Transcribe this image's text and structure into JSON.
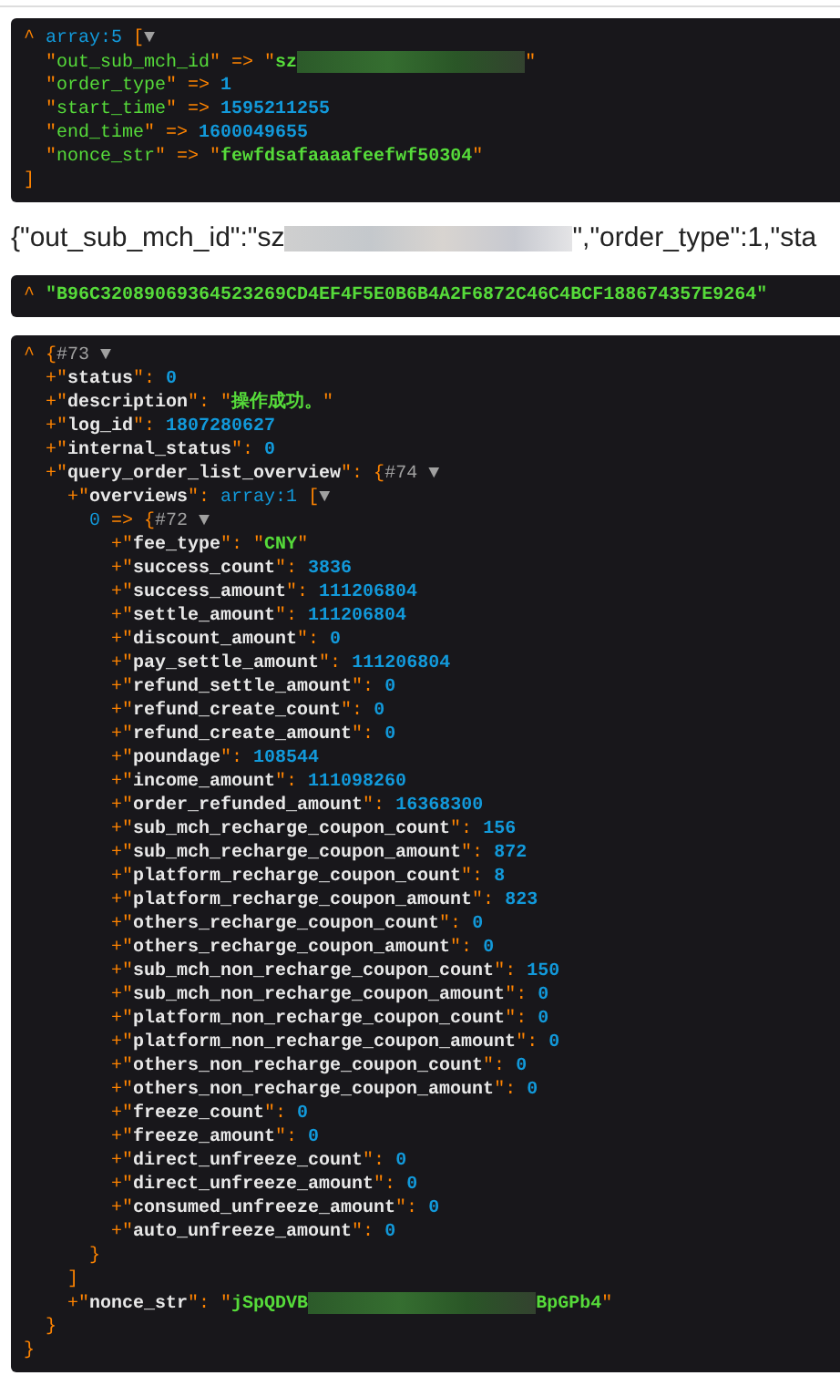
{
  "dumps": [
    {
      "kind": "dark",
      "root": {
        "tokens": [
          {
            "kind": "punct",
            "text": "^ "
          },
          {
            "kind": "type",
            "text": "array:5"
          },
          {
            "kind": "punct",
            "text": " ["
          },
          {
            "kind": "toggle",
            "text": "▼"
          }
        ],
        "children": [
          {
            "tokens": [
              {
                "kind": "punct",
                "text": "\""
              },
              {
                "kind": "str",
                "text": "out_sub_mch_id"
              },
              {
                "kind": "punct",
                "text": "\" => \""
              },
              {
                "kind": "strb",
                "text": "sz"
              },
              {
                "kind": "redacted"
              },
              {
                "kind": "punct",
                "text": "\""
              }
            ]
          },
          {
            "tokens": [
              {
                "kind": "punct",
                "text": "\""
              },
              {
                "kind": "str",
                "text": "order_type"
              },
              {
                "kind": "punct",
                "text": "\" => "
              },
              {
                "kind": "num",
                "text": "1"
              }
            ]
          },
          {
            "tokens": [
              {
                "kind": "punct",
                "text": "\""
              },
              {
                "kind": "str",
                "text": "start_time"
              },
              {
                "kind": "punct",
                "text": "\" => "
              },
              {
                "kind": "num",
                "text": "1595211255"
              }
            ]
          },
          {
            "tokens": [
              {
                "kind": "punct",
                "text": "\""
              },
              {
                "kind": "str",
                "text": "end_time"
              },
              {
                "kind": "punct",
                "text": "\" => "
              },
              {
                "kind": "num",
                "text": "1600049655"
              }
            ]
          },
          {
            "tokens": [
              {
                "kind": "punct",
                "text": "\""
              },
              {
                "kind": "str",
                "text": "nonce_str"
              },
              {
                "kind": "punct",
                "text": "\" => \""
              },
              {
                "kind": "strb",
                "text": "fewfdsafaaaafeefwf50304"
              },
              {
                "kind": "punct",
                "text": "\""
              }
            ]
          }
        ],
        "closing": [
          {
            "kind": "punct",
            "text": "]"
          }
        ]
      }
    },
    {
      "kind": "plain",
      "tokens": [
        {
          "kind": "plain",
          "text": "{\"out_sub_mch_id\":\"sz"
        },
        {
          "kind": "redacted"
        },
        {
          "kind": "plain",
          "text": "\",\"order_type\":1,\"sta"
        }
      ]
    },
    {
      "kind": "dark",
      "root": {
        "tokens": [
          {
            "kind": "punct",
            "text": "^ "
          },
          {
            "kind": "strb",
            "text": "\"B96C32089069364523269CD4EF4F5E0B6B4A2F6872C46C4BCF188674357E9264\""
          }
        ]
      }
    },
    {
      "kind": "dark",
      "root": {
        "tokens": [
          {
            "kind": "punct",
            "text": "^ {"
          },
          {
            "kind": "meta",
            "text": "#73"
          },
          {
            "kind": "toggle",
            "text": " ▼"
          }
        ],
        "children": [
          {
            "tokens": [
              {
                "kind": "punct",
                "text": "+\""
              },
              {
                "kind": "key",
                "text": "status"
              },
              {
                "kind": "punct",
                "text": "\": "
              },
              {
                "kind": "num",
                "text": "0"
              }
            ]
          },
          {
            "tokens": [
              {
                "kind": "punct",
                "text": "+\""
              },
              {
                "kind": "key",
                "text": "description"
              },
              {
                "kind": "punct",
                "text": "\": \""
              },
              {
                "kind": "strb",
                "text": "操作成功。"
              },
              {
                "kind": "punct",
                "text": "\""
              }
            ]
          },
          {
            "tokens": [
              {
                "kind": "punct",
                "text": "+\""
              },
              {
                "kind": "key",
                "text": "log_id"
              },
              {
                "kind": "punct",
                "text": "\": "
              },
              {
                "kind": "num",
                "text": "1807280627"
              }
            ]
          },
          {
            "tokens": [
              {
                "kind": "punct",
                "text": "+\""
              },
              {
                "kind": "key",
                "text": "internal_status"
              },
              {
                "kind": "punct",
                "text": "\": "
              },
              {
                "kind": "num",
                "text": "0"
              }
            ]
          },
          {
            "tokens": [
              {
                "kind": "punct",
                "text": "+\""
              },
              {
                "kind": "key",
                "text": "query_order_list_overview"
              },
              {
                "kind": "punct",
                "text": "\": {"
              },
              {
                "kind": "meta",
                "text": "#74"
              },
              {
                "kind": "toggle",
                "text": " ▼"
              }
            ],
            "children": [
              {
                "tokens": [
                  {
                    "kind": "punct",
                    "text": "+\""
                  },
                  {
                    "kind": "key",
                    "text": "overviews"
                  },
                  {
                    "kind": "punct",
                    "text": "\": "
                  },
                  {
                    "kind": "type",
                    "text": "array:1"
                  },
                  {
                    "kind": "punct",
                    "text": " ["
                  },
                  {
                    "kind": "toggle",
                    "text": "▼"
                  }
                ],
                "children": [
                  {
                    "tokens": [
                      {
                        "kind": "type",
                        "text": "0"
                      },
                      {
                        "kind": "punct",
                        "text": " => {"
                      },
                      {
                        "kind": "meta",
                        "text": "#72"
                      },
                      {
                        "kind": "toggle",
                        "text": " ▼"
                      }
                    ],
                    "children": [
                      {
                        "tokens": [
                          {
                            "kind": "punct",
                            "text": "+\""
                          },
                          {
                            "kind": "key",
                            "text": "fee_type"
                          },
                          {
                            "kind": "punct",
                            "text": "\": \""
                          },
                          {
                            "kind": "strb",
                            "text": "CNY"
                          },
                          {
                            "kind": "punct",
                            "text": "\""
                          }
                        ]
                      },
                      {
                        "tokens": [
                          {
                            "kind": "punct",
                            "text": "+\""
                          },
                          {
                            "kind": "key",
                            "text": "success_count"
                          },
                          {
                            "kind": "punct",
                            "text": "\": "
                          },
                          {
                            "kind": "num",
                            "text": "3836"
                          }
                        ]
                      },
                      {
                        "tokens": [
                          {
                            "kind": "punct",
                            "text": "+\""
                          },
                          {
                            "kind": "key",
                            "text": "success_amount"
                          },
                          {
                            "kind": "punct",
                            "text": "\": "
                          },
                          {
                            "kind": "num",
                            "text": "111206804"
                          }
                        ]
                      },
                      {
                        "tokens": [
                          {
                            "kind": "punct",
                            "text": "+\""
                          },
                          {
                            "kind": "key",
                            "text": "settle_amount"
                          },
                          {
                            "kind": "punct",
                            "text": "\": "
                          },
                          {
                            "kind": "num",
                            "text": "111206804"
                          }
                        ]
                      },
                      {
                        "tokens": [
                          {
                            "kind": "punct",
                            "text": "+\""
                          },
                          {
                            "kind": "key",
                            "text": "discount_amount"
                          },
                          {
                            "kind": "punct",
                            "text": "\": "
                          },
                          {
                            "kind": "num",
                            "text": "0"
                          }
                        ]
                      },
                      {
                        "tokens": [
                          {
                            "kind": "punct",
                            "text": "+\""
                          },
                          {
                            "kind": "key",
                            "text": "pay_settle_amount"
                          },
                          {
                            "kind": "punct",
                            "text": "\": "
                          },
                          {
                            "kind": "num",
                            "text": "111206804"
                          }
                        ]
                      },
                      {
                        "tokens": [
                          {
                            "kind": "punct",
                            "text": "+\""
                          },
                          {
                            "kind": "key",
                            "text": "refund_settle_amount"
                          },
                          {
                            "kind": "punct",
                            "text": "\": "
                          },
                          {
                            "kind": "num",
                            "text": "0"
                          }
                        ]
                      },
                      {
                        "tokens": [
                          {
                            "kind": "punct",
                            "text": "+\""
                          },
                          {
                            "kind": "key",
                            "text": "refund_create_count"
                          },
                          {
                            "kind": "punct",
                            "text": "\": "
                          },
                          {
                            "kind": "num",
                            "text": "0"
                          }
                        ]
                      },
                      {
                        "tokens": [
                          {
                            "kind": "punct",
                            "text": "+\""
                          },
                          {
                            "kind": "key",
                            "text": "refund_create_amount"
                          },
                          {
                            "kind": "punct",
                            "text": "\": "
                          },
                          {
                            "kind": "num",
                            "text": "0"
                          }
                        ]
                      },
                      {
                        "tokens": [
                          {
                            "kind": "punct",
                            "text": "+\""
                          },
                          {
                            "kind": "key",
                            "text": "poundage"
                          },
                          {
                            "kind": "punct",
                            "text": "\": "
                          },
                          {
                            "kind": "num",
                            "text": "108544"
                          }
                        ]
                      },
                      {
                        "tokens": [
                          {
                            "kind": "punct",
                            "text": "+\""
                          },
                          {
                            "kind": "key",
                            "text": "income_amount"
                          },
                          {
                            "kind": "punct",
                            "text": "\": "
                          },
                          {
                            "kind": "num",
                            "text": "111098260"
                          }
                        ]
                      },
                      {
                        "tokens": [
                          {
                            "kind": "punct",
                            "text": "+\""
                          },
                          {
                            "kind": "key",
                            "text": "order_refunded_amount"
                          },
                          {
                            "kind": "punct",
                            "text": "\": "
                          },
                          {
                            "kind": "num",
                            "text": "16368300"
                          }
                        ]
                      },
                      {
                        "tokens": [
                          {
                            "kind": "punct",
                            "text": "+\""
                          },
                          {
                            "kind": "key",
                            "text": "sub_mch_recharge_coupon_count"
                          },
                          {
                            "kind": "punct",
                            "text": "\": "
                          },
                          {
                            "kind": "num",
                            "text": "156"
                          }
                        ]
                      },
                      {
                        "tokens": [
                          {
                            "kind": "punct",
                            "text": "+\""
                          },
                          {
                            "kind": "key",
                            "text": "sub_mch_recharge_coupon_amount"
                          },
                          {
                            "kind": "punct",
                            "text": "\": "
                          },
                          {
                            "kind": "num",
                            "text": "872"
                          }
                        ]
                      },
                      {
                        "tokens": [
                          {
                            "kind": "punct",
                            "text": "+\""
                          },
                          {
                            "kind": "key",
                            "text": "platform_recharge_coupon_count"
                          },
                          {
                            "kind": "punct",
                            "text": "\": "
                          },
                          {
                            "kind": "num",
                            "text": "8"
                          }
                        ]
                      },
                      {
                        "tokens": [
                          {
                            "kind": "punct",
                            "text": "+\""
                          },
                          {
                            "kind": "key",
                            "text": "platform_recharge_coupon_amount"
                          },
                          {
                            "kind": "punct",
                            "text": "\": "
                          },
                          {
                            "kind": "num",
                            "text": "823"
                          }
                        ]
                      },
                      {
                        "tokens": [
                          {
                            "kind": "punct",
                            "text": "+\""
                          },
                          {
                            "kind": "key",
                            "text": "others_recharge_coupon_count"
                          },
                          {
                            "kind": "punct",
                            "text": "\": "
                          },
                          {
                            "kind": "num",
                            "text": "0"
                          }
                        ]
                      },
                      {
                        "tokens": [
                          {
                            "kind": "punct",
                            "text": "+\""
                          },
                          {
                            "kind": "key",
                            "text": "others_recharge_coupon_amount"
                          },
                          {
                            "kind": "punct",
                            "text": "\": "
                          },
                          {
                            "kind": "num",
                            "text": "0"
                          }
                        ]
                      },
                      {
                        "tokens": [
                          {
                            "kind": "punct",
                            "text": "+\""
                          },
                          {
                            "kind": "key",
                            "text": "sub_mch_non_recharge_coupon_count"
                          },
                          {
                            "kind": "punct",
                            "text": "\": "
                          },
                          {
                            "kind": "num",
                            "text": "150"
                          }
                        ]
                      },
                      {
                        "tokens": [
                          {
                            "kind": "punct",
                            "text": "+\""
                          },
                          {
                            "kind": "key",
                            "text": "sub_mch_non_recharge_coupon_amount"
                          },
                          {
                            "kind": "punct",
                            "text": "\": "
                          },
                          {
                            "kind": "num",
                            "text": "0"
                          }
                        ]
                      },
                      {
                        "tokens": [
                          {
                            "kind": "punct",
                            "text": "+\""
                          },
                          {
                            "kind": "key",
                            "text": "platform_non_recharge_coupon_count"
                          },
                          {
                            "kind": "punct",
                            "text": "\": "
                          },
                          {
                            "kind": "num",
                            "text": "0"
                          }
                        ]
                      },
                      {
                        "tokens": [
                          {
                            "kind": "punct",
                            "text": "+\""
                          },
                          {
                            "kind": "key",
                            "text": "platform_non_recharge_coupon_amount"
                          },
                          {
                            "kind": "punct",
                            "text": "\": "
                          },
                          {
                            "kind": "num",
                            "text": "0"
                          }
                        ]
                      },
                      {
                        "tokens": [
                          {
                            "kind": "punct",
                            "text": "+\""
                          },
                          {
                            "kind": "key",
                            "text": "others_non_recharge_coupon_count"
                          },
                          {
                            "kind": "punct",
                            "text": "\": "
                          },
                          {
                            "kind": "num",
                            "text": "0"
                          }
                        ]
                      },
                      {
                        "tokens": [
                          {
                            "kind": "punct",
                            "text": "+\""
                          },
                          {
                            "kind": "key",
                            "text": "others_non_recharge_coupon_amount"
                          },
                          {
                            "kind": "punct",
                            "text": "\": "
                          },
                          {
                            "kind": "num",
                            "text": "0"
                          }
                        ]
                      },
                      {
                        "tokens": [
                          {
                            "kind": "punct",
                            "text": "+\""
                          },
                          {
                            "kind": "key",
                            "text": "freeze_count"
                          },
                          {
                            "kind": "punct",
                            "text": "\": "
                          },
                          {
                            "kind": "num",
                            "text": "0"
                          }
                        ]
                      },
                      {
                        "tokens": [
                          {
                            "kind": "punct",
                            "text": "+\""
                          },
                          {
                            "kind": "key",
                            "text": "freeze_amount"
                          },
                          {
                            "kind": "punct",
                            "text": "\": "
                          },
                          {
                            "kind": "num",
                            "text": "0"
                          }
                        ]
                      },
                      {
                        "tokens": [
                          {
                            "kind": "punct",
                            "text": "+\""
                          },
                          {
                            "kind": "key",
                            "text": "direct_unfreeze_count"
                          },
                          {
                            "kind": "punct",
                            "text": "\": "
                          },
                          {
                            "kind": "num",
                            "text": "0"
                          }
                        ]
                      },
                      {
                        "tokens": [
                          {
                            "kind": "punct",
                            "text": "+\""
                          },
                          {
                            "kind": "key",
                            "text": "direct_unfreeze_amount"
                          },
                          {
                            "kind": "punct",
                            "text": "\": "
                          },
                          {
                            "kind": "num",
                            "text": "0"
                          }
                        ]
                      },
                      {
                        "tokens": [
                          {
                            "kind": "punct",
                            "text": "+\""
                          },
                          {
                            "kind": "key",
                            "text": "consumed_unfreeze_amount"
                          },
                          {
                            "kind": "punct",
                            "text": "\": "
                          },
                          {
                            "kind": "num",
                            "text": "0"
                          }
                        ]
                      },
                      {
                        "tokens": [
                          {
                            "kind": "punct",
                            "text": "+\""
                          },
                          {
                            "kind": "key",
                            "text": "auto_unfreeze_amount"
                          },
                          {
                            "kind": "punct",
                            "text": "\": "
                          },
                          {
                            "kind": "num",
                            "text": "0"
                          }
                        ]
                      }
                    ],
                    "closing": [
                      {
                        "kind": "punct",
                        "text": "}"
                      }
                    ]
                  }
                ],
                "closing": [
                  {
                    "kind": "punct",
                    "text": "]"
                  }
                ]
              },
              {
                "tokens": [
                  {
                    "kind": "punct",
                    "text": "+\""
                  },
                  {
                    "kind": "key",
                    "text": "nonce_str"
                  },
                  {
                    "kind": "punct",
                    "text": "\": \""
                  },
                  {
                    "kind": "strb",
                    "text": "jSpQDVB"
                  },
                  {
                    "kind": "redacted"
                  },
                  {
                    "kind": "strb",
                    "text": "BpGPb4"
                  },
                  {
                    "kind": "punct",
                    "text": "\""
                  }
                ]
              }
            ],
            "closing": [
              {
                "kind": "punct",
                "text": "}"
              }
            ]
          }
        ],
        "closing": [
          {
            "kind": "punct",
            "text": "}"
          }
        ]
      }
    }
  ]
}
